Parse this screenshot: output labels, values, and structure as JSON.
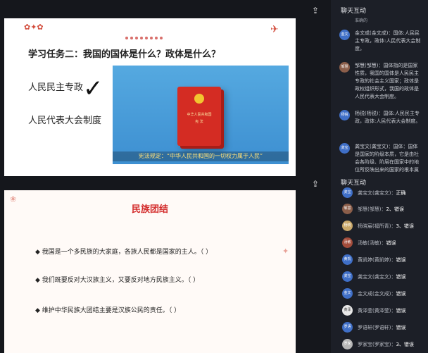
{
  "colors": {
    "accent_red": "#d32b2b",
    "sidebar_bg": "#1c1f27",
    "avatar_blue": "#3f6fc7"
  },
  "slide1": {
    "title": "学习任务二：我国的国体是什么？政体是什么？",
    "items": [
      "人民民主专政",
      "人民代表大会制度"
    ],
    "check_mark": "✓",
    "book_title_lines": [
      "中华人民共和国",
      "宪 法"
    ],
    "caption": "宪法规定：“中华人民共和国的一切权力属于人民”"
  },
  "slide2": {
    "title": "民族团结",
    "items": [
      "◆ 我国是一个多民族的大家庭，各族人民都是国家的主人。（ ）",
      "◆ 我们既要反对大汉族主义，又要反对地方民族主义。（ ）",
      "◆ 维护中华民族大团结主要是汉族公民的责任。（ ）"
    ]
  },
  "chat1": {
    "header": "聊天互动",
    "top_fragment": "准确的",
    "messages": [
      {
        "avatar": "金文",
        "text": "金文成(金文成)：国体:人民民主专政，政体:人民代表大会制度。"
      },
      {
        "avatar": "邹慧",
        "text": "邹慧(邹慧)：国体指的是国家性质，我国的国体是人民民主专政的社会主义国家；政体是政权组织形式，我国的政体是人民代表大会制度。"
      },
      {
        "avatar": "杨锐",
        "text": "杨锐(杨锐)：国体:人民民主专政，政体:人民代表大会制度。"
      },
      {
        "avatar": "龚宝",
        "text": "龚宝文(龚宝文)：国体：国体是国家的阶级本质，它是由社会各阶级、阶层在国家中的地位所反映出来的国家的根本属"
      }
    ]
  },
  "chat2": {
    "header": "聊天互动",
    "rows": [
      {
        "avatar": "龚宝",
        "name": "龚宝文(龚宝文)：",
        "text": "正确"
      },
      {
        "avatar": "邹慧",
        "name": "邹慧(邹慧)：",
        "text": "2、错误"
      },
      {
        "avatar": "杨晓",
        "name": "杨晓宸(福所青)：",
        "text": "3、错误"
      },
      {
        "avatar": "汤敏",
        "name": "汤敏(汤敏)：",
        "text": "错误"
      },
      {
        "avatar": "黄凯",
        "name": "黄凯婷(黄凯婷)：",
        "text": "错误"
      },
      {
        "avatar": "龚宝",
        "name": "龚宝文(龚宝文)：",
        "text": "错误"
      },
      {
        "avatar": "金文",
        "name": "金文成(金文成)：",
        "text": "错误"
      },
      {
        "avatar": "黄泽",
        "name": "黄泽莹(黄泽莹)：",
        "text": "错误"
      },
      {
        "avatar": "罗语",
        "name": "罗语轩(罗语轩)：",
        "text": "错误"
      },
      {
        "avatar": "罗家",
        "name": "罗家宝(罗家宝)：",
        "text": "3、错误"
      }
    ]
  }
}
